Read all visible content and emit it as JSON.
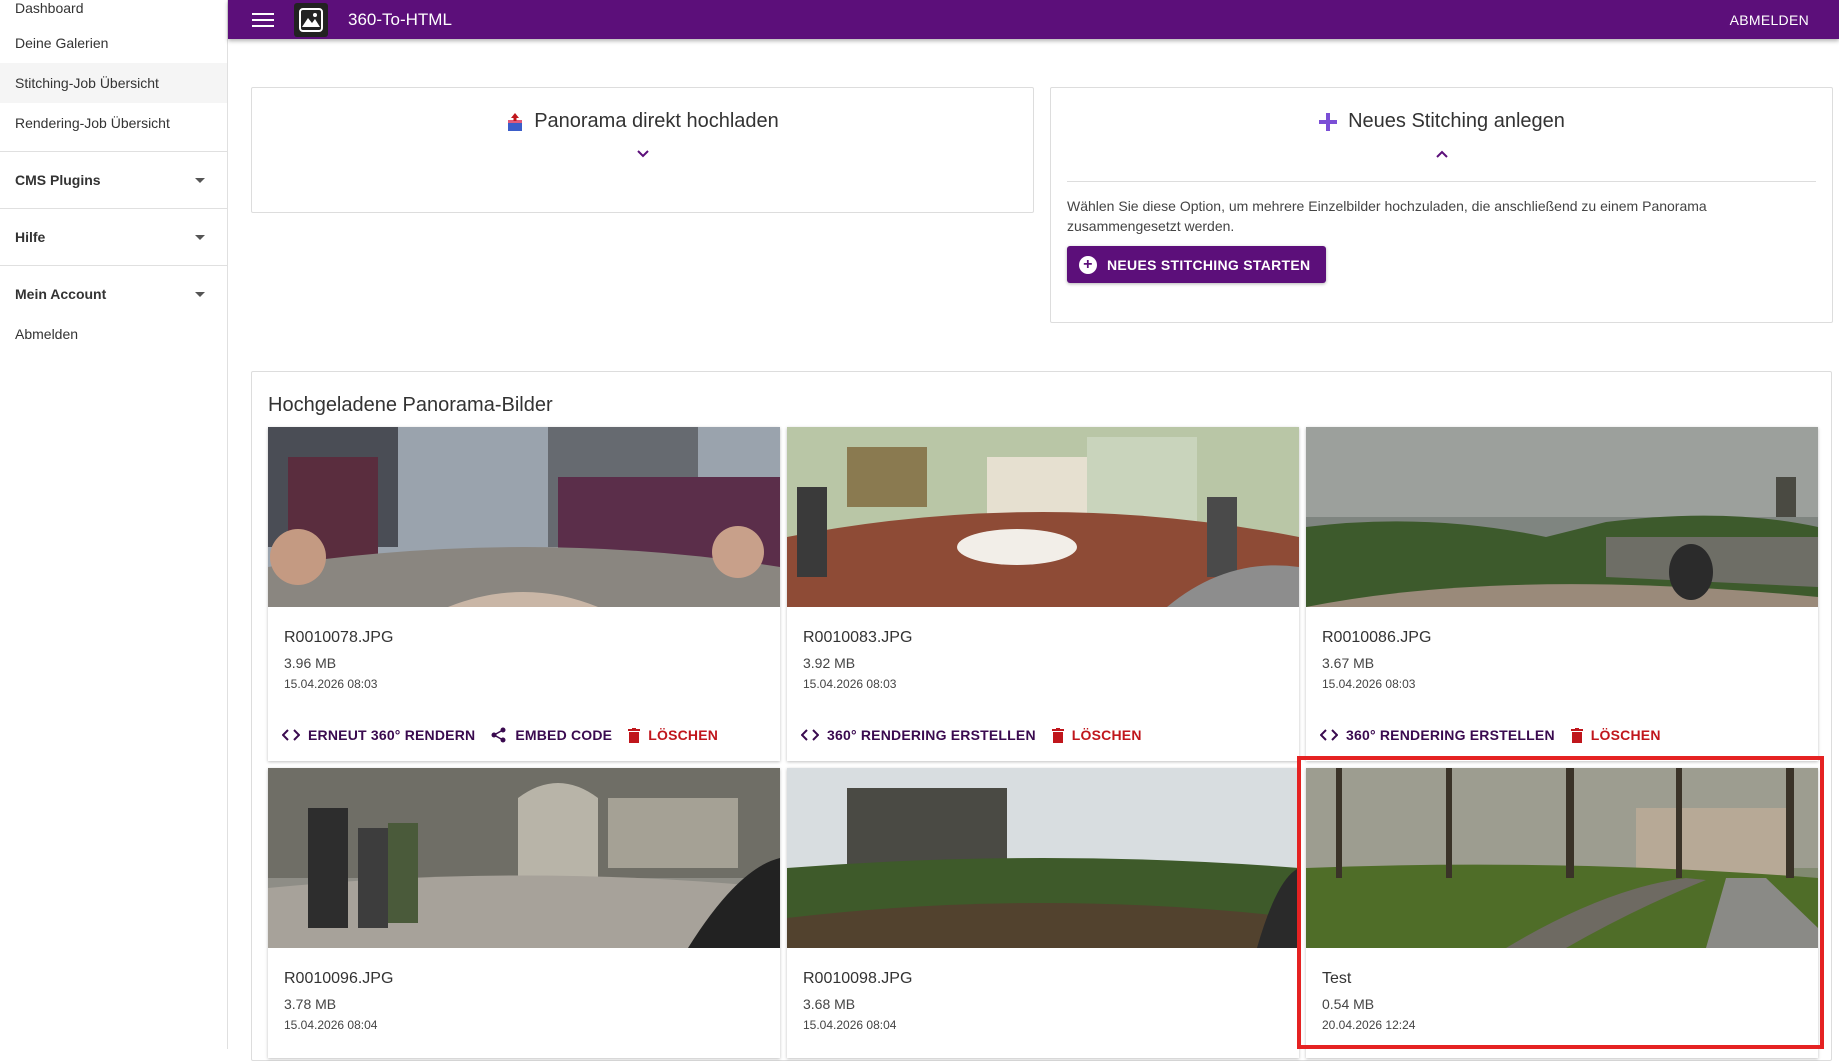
{
  "sidebar": {
    "items": [
      {
        "label": "Dashboard"
      },
      {
        "label": "Deine Galerien"
      },
      {
        "label": "Stitching-Job Übersicht"
      },
      {
        "label": "Rendering-Job Übersicht"
      }
    ],
    "groups": [
      {
        "label": "CMS Plugins"
      },
      {
        "label": "Hilfe"
      },
      {
        "label": "Mein Account"
      }
    ],
    "logout": "Abmelden"
  },
  "topbar": {
    "title": "360-To-HTML",
    "logout": "ABMELDEN"
  },
  "upload_card": {
    "title": "Panorama direkt hochladen"
  },
  "stitching_card": {
    "title": "Neues Stitching anlegen",
    "description": "Wählen Sie diese Option, um mehrere Einzelbilder hochzuladen, die anschließend zu einem Panorama zusammengesetzt werden.",
    "button": "NEUES STITCHING STARTEN"
  },
  "gallery": {
    "title": "Hochgeladene Panorama-Bilder",
    "items": [
      {
        "name": "R0010078.JPG",
        "size": "3.96 MB",
        "date": "15.04.2026 08:03",
        "actions": [
          "ERNEUT 360° RENDERN",
          "EMBED CODE",
          "LÖSCHEN"
        ]
      },
      {
        "name": "R0010083.JPG",
        "size": "3.92 MB",
        "date": "15.04.2026 08:03",
        "actions": [
          "360° RENDERING ERSTELLEN",
          "LÖSCHEN"
        ]
      },
      {
        "name": "R0010086.JPG",
        "size": "3.67 MB",
        "date": "15.04.2026 08:03",
        "actions": [
          "360° RENDERING ERSTELLEN",
          "LÖSCHEN"
        ]
      },
      {
        "name": "R0010096.JPG",
        "size": "3.78 MB",
        "date": "15.04.2026 08:04"
      },
      {
        "name": "R0010098.JPG",
        "size": "3.68 MB",
        "date": "15.04.2026 08:04"
      },
      {
        "name": "Test",
        "size": "0.54 MB",
        "date": "20.04.2026 12:24"
      }
    ]
  },
  "colors": {
    "primary": "#5c0f7a",
    "danger": "#c0161c",
    "highlight": "#e52222"
  }
}
